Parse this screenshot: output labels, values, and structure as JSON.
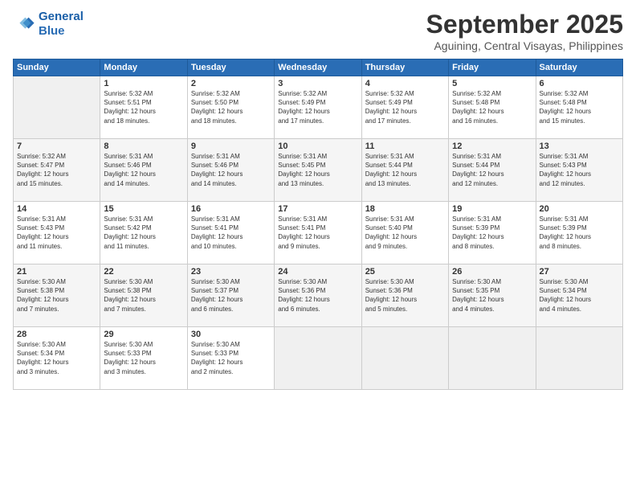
{
  "logo": {
    "line1": "General",
    "line2": "Blue"
  },
  "header": {
    "title": "September 2025",
    "subtitle": "Aguining, Central Visayas, Philippines"
  },
  "weekdays": [
    "Sunday",
    "Monday",
    "Tuesday",
    "Wednesday",
    "Thursday",
    "Friday",
    "Saturday"
  ],
  "weeks": [
    [
      {
        "day": "",
        "info": ""
      },
      {
        "day": "1",
        "info": "Sunrise: 5:32 AM\nSunset: 5:51 PM\nDaylight: 12 hours\nand 18 minutes."
      },
      {
        "day": "2",
        "info": "Sunrise: 5:32 AM\nSunset: 5:50 PM\nDaylight: 12 hours\nand 18 minutes."
      },
      {
        "day": "3",
        "info": "Sunrise: 5:32 AM\nSunset: 5:49 PM\nDaylight: 12 hours\nand 17 minutes."
      },
      {
        "day": "4",
        "info": "Sunrise: 5:32 AM\nSunset: 5:49 PM\nDaylight: 12 hours\nand 17 minutes."
      },
      {
        "day": "5",
        "info": "Sunrise: 5:32 AM\nSunset: 5:48 PM\nDaylight: 12 hours\nand 16 minutes."
      },
      {
        "day": "6",
        "info": "Sunrise: 5:32 AM\nSunset: 5:48 PM\nDaylight: 12 hours\nand 15 minutes."
      }
    ],
    [
      {
        "day": "7",
        "info": "Sunrise: 5:32 AM\nSunset: 5:47 PM\nDaylight: 12 hours\nand 15 minutes."
      },
      {
        "day": "8",
        "info": "Sunrise: 5:31 AM\nSunset: 5:46 PM\nDaylight: 12 hours\nand 14 minutes."
      },
      {
        "day": "9",
        "info": "Sunrise: 5:31 AM\nSunset: 5:46 PM\nDaylight: 12 hours\nand 14 minutes."
      },
      {
        "day": "10",
        "info": "Sunrise: 5:31 AM\nSunset: 5:45 PM\nDaylight: 12 hours\nand 13 minutes."
      },
      {
        "day": "11",
        "info": "Sunrise: 5:31 AM\nSunset: 5:44 PM\nDaylight: 12 hours\nand 13 minutes."
      },
      {
        "day": "12",
        "info": "Sunrise: 5:31 AM\nSunset: 5:44 PM\nDaylight: 12 hours\nand 12 minutes."
      },
      {
        "day": "13",
        "info": "Sunrise: 5:31 AM\nSunset: 5:43 PM\nDaylight: 12 hours\nand 12 minutes."
      }
    ],
    [
      {
        "day": "14",
        "info": "Sunrise: 5:31 AM\nSunset: 5:43 PM\nDaylight: 12 hours\nand 11 minutes."
      },
      {
        "day": "15",
        "info": "Sunrise: 5:31 AM\nSunset: 5:42 PM\nDaylight: 12 hours\nand 11 minutes."
      },
      {
        "day": "16",
        "info": "Sunrise: 5:31 AM\nSunset: 5:41 PM\nDaylight: 12 hours\nand 10 minutes."
      },
      {
        "day": "17",
        "info": "Sunrise: 5:31 AM\nSunset: 5:41 PM\nDaylight: 12 hours\nand 9 minutes."
      },
      {
        "day": "18",
        "info": "Sunrise: 5:31 AM\nSunset: 5:40 PM\nDaylight: 12 hours\nand 9 minutes."
      },
      {
        "day": "19",
        "info": "Sunrise: 5:31 AM\nSunset: 5:39 PM\nDaylight: 12 hours\nand 8 minutes."
      },
      {
        "day": "20",
        "info": "Sunrise: 5:31 AM\nSunset: 5:39 PM\nDaylight: 12 hours\nand 8 minutes."
      }
    ],
    [
      {
        "day": "21",
        "info": "Sunrise: 5:30 AM\nSunset: 5:38 PM\nDaylight: 12 hours\nand 7 minutes."
      },
      {
        "day": "22",
        "info": "Sunrise: 5:30 AM\nSunset: 5:38 PM\nDaylight: 12 hours\nand 7 minutes."
      },
      {
        "day": "23",
        "info": "Sunrise: 5:30 AM\nSunset: 5:37 PM\nDaylight: 12 hours\nand 6 minutes."
      },
      {
        "day": "24",
        "info": "Sunrise: 5:30 AM\nSunset: 5:36 PM\nDaylight: 12 hours\nand 6 minutes."
      },
      {
        "day": "25",
        "info": "Sunrise: 5:30 AM\nSunset: 5:36 PM\nDaylight: 12 hours\nand 5 minutes."
      },
      {
        "day": "26",
        "info": "Sunrise: 5:30 AM\nSunset: 5:35 PM\nDaylight: 12 hours\nand 4 minutes."
      },
      {
        "day": "27",
        "info": "Sunrise: 5:30 AM\nSunset: 5:34 PM\nDaylight: 12 hours\nand 4 minutes."
      }
    ],
    [
      {
        "day": "28",
        "info": "Sunrise: 5:30 AM\nSunset: 5:34 PM\nDaylight: 12 hours\nand 3 minutes."
      },
      {
        "day": "29",
        "info": "Sunrise: 5:30 AM\nSunset: 5:33 PM\nDaylight: 12 hours\nand 3 minutes."
      },
      {
        "day": "30",
        "info": "Sunrise: 5:30 AM\nSunset: 5:33 PM\nDaylight: 12 hours\nand 2 minutes."
      },
      {
        "day": "",
        "info": ""
      },
      {
        "day": "",
        "info": ""
      },
      {
        "day": "",
        "info": ""
      },
      {
        "day": "",
        "info": ""
      }
    ]
  ]
}
